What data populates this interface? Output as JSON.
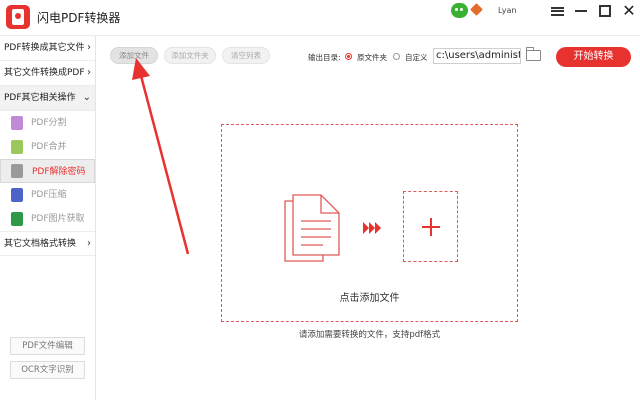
{
  "app": {
    "title": "闪电PDF转换器",
    "username": "Lyan",
    "accent_color": "#e8322f"
  },
  "sidebar": {
    "sections": [
      {
        "label": "PDF转换成其它文件",
        "chevron": "›"
      },
      {
        "label": "其它文件转换成PDF",
        "chevron": "›"
      },
      {
        "label": "PDF其它相关操作",
        "chevron": "⌄"
      }
    ],
    "sub_items": [
      {
        "label": "PDF分割",
        "icon": "split-icon",
        "color": "#c08ad8"
      },
      {
        "label": "PDF合并",
        "icon": "merge-icon",
        "color": "#9bc75b"
      },
      {
        "label": "PDF解除密码",
        "icon": "unlock-icon",
        "color": "#9a9a9a",
        "active": true
      },
      {
        "label": "PDF压缩",
        "icon": "compress-icon",
        "color": "#4d63c8"
      },
      {
        "label": "PDF图片获取",
        "icon": "image-extract-icon",
        "color": "#2e9a48"
      }
    ],
    "last_section": {
      "label": "其它文档格式转换",
      "chevron": "›"
    },
    "bottom_buttons": [
      "PDF文件编辑",
      "OCR文字识别"
    ]
  },
  "toolbar": {
    "add_file": "添加文件",
    "add_folder": "添加文件夹",
    "clear_list": "清空列表",
    "output_label": "输出目录:",
    "radio_original": "原文件夹",
    "radio_custom": "自定义",
    "output_path": "c:\\users\\administ",
    "start_button": "开始转换"
  },
  "dropzone": {
    "label": "点击添加文件",
    "hint": "请添加需要转换的文件，支持pdf格式"
  }
}
